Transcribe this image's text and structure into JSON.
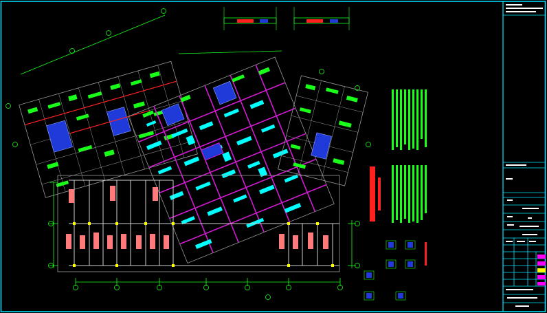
{
  "drawing": {
    "colors": {
      "background": "#000000",
      "frame": "#00e5ff",
      "grid": "#9a9a9a",
      "green": "#19ff19",
      "cyan": "#00ffff",
      "magenta": "#d21bd2",
      "salmon": "#ff7a7a",
      "blue": "#1f3ad8",
      "red": "#ff2020",
      "yellow": "#ffff00",
      "white": "#ffffff"
    },
    "icons": [
      "axis-bubble-icon",
      "dimension-tick-icon"
    ]
  },
  "notes": {
    "heading": ""
  },
  "title_block": {
    "rows": 18
  }
}
